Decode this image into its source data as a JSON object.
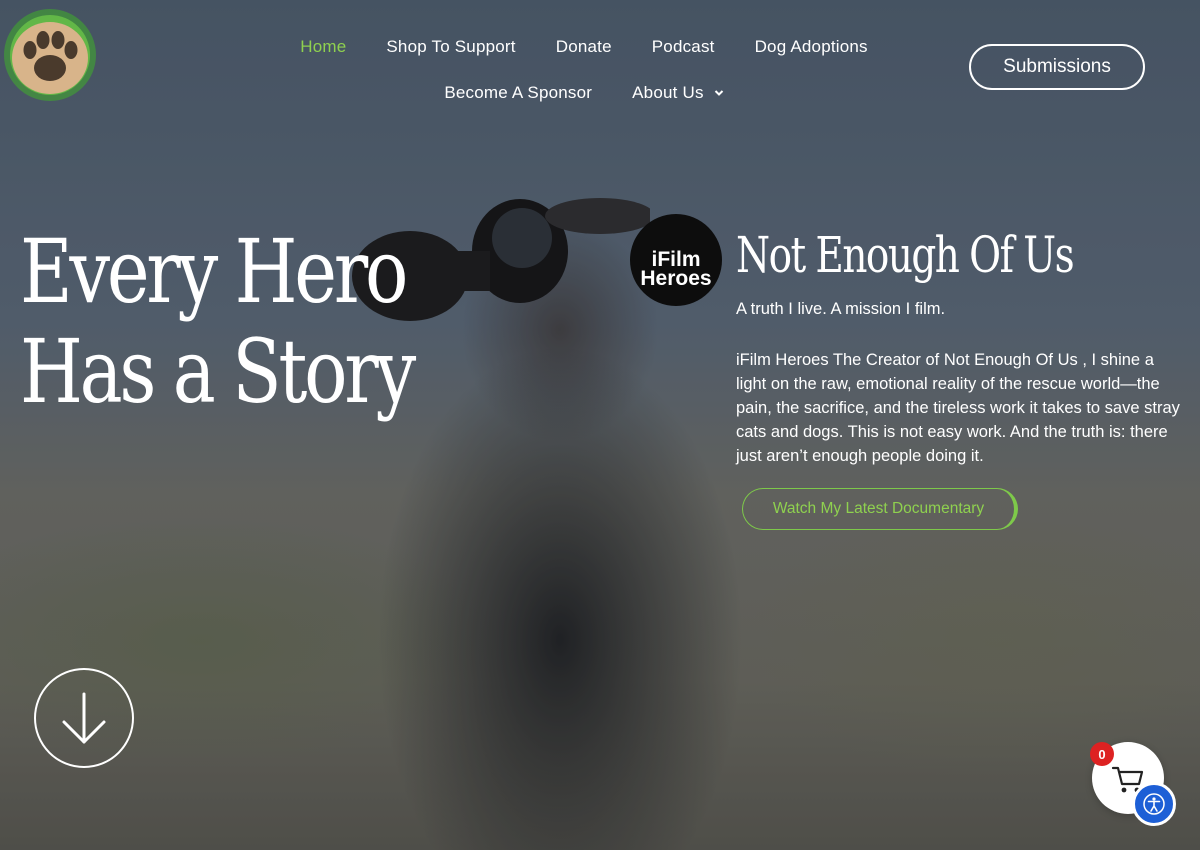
{
  "brand": {
    "logo_icon": "paw-print-icon",
    "colors": {
      "accent": "#8fd14f",
      "badge": "#dd2222",
      "accessibility": "#1d5fd6"
    }
  },
  "nav": {
    "row1": [
      "Home",
      "Shop To Support",
      "Donate",
      "Podcast",
      "Dog Adoptions"
    ],
    "row2": [
      "Become A Sponsor",
      "About Us"
    ],
    "active": "Home"
  },
  "header": {
    "cta_label": "Submissions"
  },
  "hero": {
    "headline_line1": "Every Hero",
    "headline_line2": "Has a Story",
    "avatar_text_line1": "iFilm",
    "avatar_text_line2": "Heroes",
    "doc_title": "Not Enough Of Us",
    "tagline": "A truth I live. A mission I film.",
    "description": "iFilm Heroes The Creator of Not Enough Of Us , I shine a light on the raw, emotional reality of the rescue world—the pain, the sacrifice, and the tireless work it takes to save stray cats and dogs. This is not easy work. And the truth is: there just aren’t enough people doing it.",
    "watch_label": "Watch My Latest Documentary"
  },
  "floating": {
    "cart_count": "0"
  }
}
